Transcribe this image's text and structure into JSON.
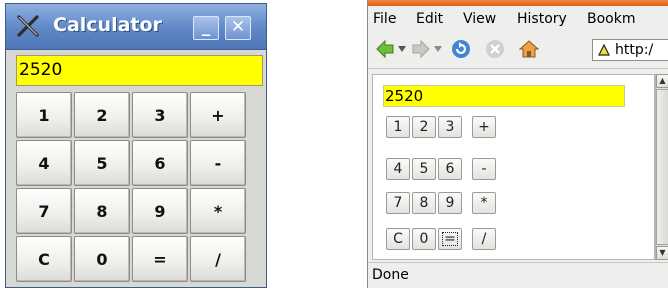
{
  "calculator": {
    "title": "Calculator",
    "minimize_label": "_",
    "close_label": "✕",
    "display_value": "2520",
    "keys": [
      "1",
      "2",
      "3",
      "+",
      "4",
      "5",
      "6",
      "-",
      "7",
      "8",
      "9",
      "*",
      "C",
      "0",
      "=",
      "/"
    ]
  },
  "browser": {
    "menu": [
      "File",
      "Edit",
      "View",
      "History",
      "Bookm"
    ],
    "url": "http:/",
    "page": {
      "display_value": "2520",
      "keys": [
        "1",
        "2",
        "3",
        "+",
        "4",
        "5",
        "6",
        "-",
        "7",
        "8",
        "9",
        "*",
        "C",
        "0",
        "=",
        "/"
      ]
    },
    "status": "Done"
  },
  "colors": {
    "display_bg": "#ffff00",
    "titlebar": "#5f86c6"
  }
}
